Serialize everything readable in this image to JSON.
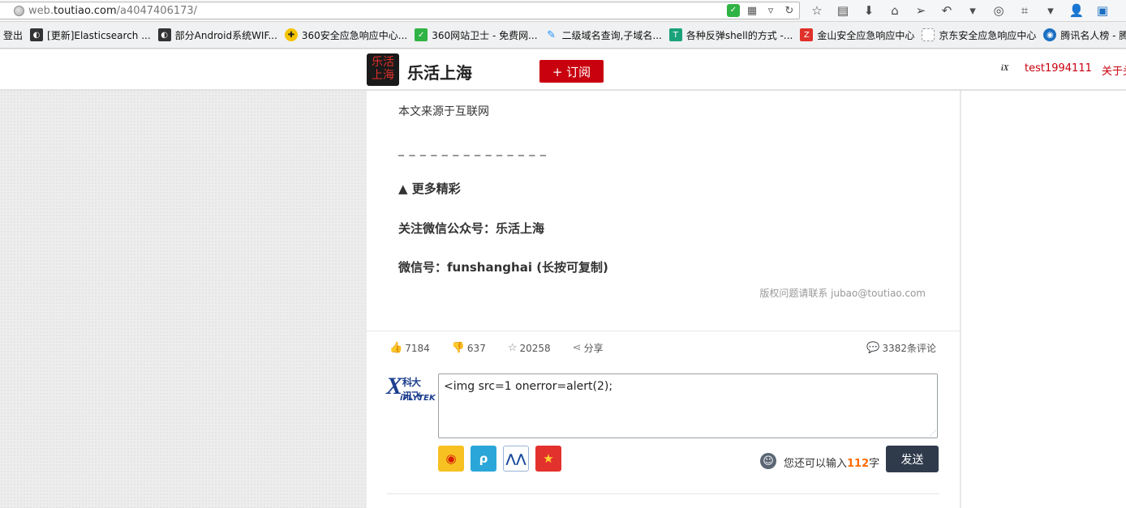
{
  "browser": {
    "url_prefix": "web.",
    "url_domain": "toutiao.com",
    "url_path": "/a4047406173/",
    "bookmarks": [
      {
        "label": "登出",
        "icon": "none",
        "color": ""
      },
      {
        "label": "[更新]Elasticsearch ...",
        "icon": "elastic-icon",
        "color": "#333333"
      },
      {
        "label": "部分Android系统WIF...",
        "icon": "android-icon",
        "color": "#333333"
      },
      {
        "label": "360安全应急响应中心...",
        "icon": "360-icon",
        "color": "#f5c400"
      },
      {
        "label": "360网站卫士 - 免费网...",
        "icon": "shield-icon",
        "color": "#2fb344"
      },
      {
        "label": "二级域名查询,子域名...",
        "icon": "pen-icon",
        "color": "#1e90ff"
      },
      {
        "label": "各种反弹shell的方式 -...",
        "icon": "tf-icon",
        "color": "#1aa37a"
      },
      {
        "label": "金山安全应急响应中心",
        "icon": "kingsoft-icon",
        "color": "#e0302a"
      },
      {
        "label": "京东安全应急响应中心",
        "icon": "blank-page-icon",
        "color": "#ffffff"
      },
      {
        "label": "腾讯名人榜 - 腾讯...",
        "icon": "tencent-icon",
        "color": "#1b6fc2"
      }
    ]
  },
  "header": {
    "logo_text": "乐活上海",
    "site_name": "乐活上海",
    "subscribe_label": "+ 订阅",
    "user_name": "test1994111",
    "about_label": "关于头"
  },
  "article": {
    "source_line": "本文来源于互联网",
    "separator": "_ _ _ _ _ _ _ _ _ _ _ _ _ _",
    "more_label": "▲ 更多精彩",
    "follow_line": "关注微信公众号：乐活上海",
    "wechat_line": "微信号：funshanghai (长按可复制)",
    "copyright": "版权问题请联系 jubao@toutiao.com"
  },
  "actions": {
    "likes": "7184",
    "dislikes": "637",
    "favorites": "20258",
    "share_label": "分享",
    "comments": "3382条评论"
  },
  "comment": {
    "brand_cn": "科大讯飞",
    "brand_en": "iFLYTEK",
    "input_value": "<img src=1 onerror=alert(2);",
    "remain_prefix": "您还可以输入",
    "remain_count": "112",
    "remain_suffix": "字",
    "send_label": "发送"
  }
}
